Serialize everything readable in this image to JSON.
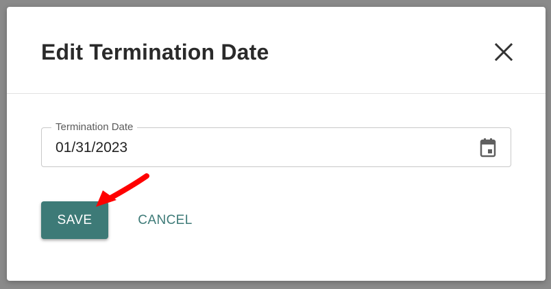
{
  "dialog": {
    "title": "Edit Termination Date",
    "close_icon": "close-icon"
  },
  "termination_date": {
    "label": "Termination Date",
    "value": "01/31/2023",
    "calendar_icon": "calendar-icon"
  },
  "actions": {
    "save_label": "SAVE",
    "cancel_label": "CANCEL"
  },
  "annotation": {
    "arrow_icon": "red-arrow-icon"
  },
  "colors": {
    "accent": "#3d7a77",
    "annotation": "#ff0000",
    "overlay": "#8a8a8a"
  }
}
